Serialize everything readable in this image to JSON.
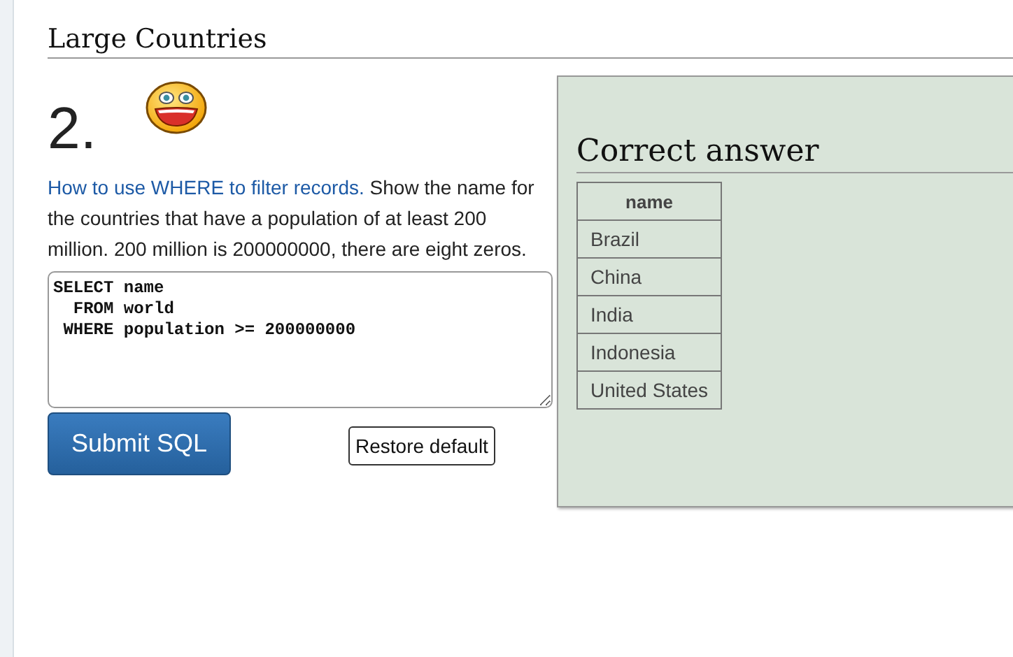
{
  "heading": "Large Countries",
  "question": {
    "number": "2.",
    "link": "How to use WHERE to filter records.",
    "text": "Show the name for the countries that have a population of at least 200 million. 200 million is 200000000, there are eight zeros."
  },
  "editor": {
    "value": "SELECT name\n  FROM world\n WHERE population >= 200000000"
  },
  "buttons": [
    {
      "kind": "primary",
      "label": "Submit SQL"
    },
    {
      "kind": "secondary",
      "label": "Restore default"
    }
  ],
  "answer": {
    "title": "Correct answer",
    "columns": [
      "name"
    ],
    "rows": [
      [
        "Brazil"
      ],
      [
        "China"
      ],
      [
        "India"
      ],
      [
        "Indonesia"
      ],
      [
        "United States"
      ]
    ]
  }
}
